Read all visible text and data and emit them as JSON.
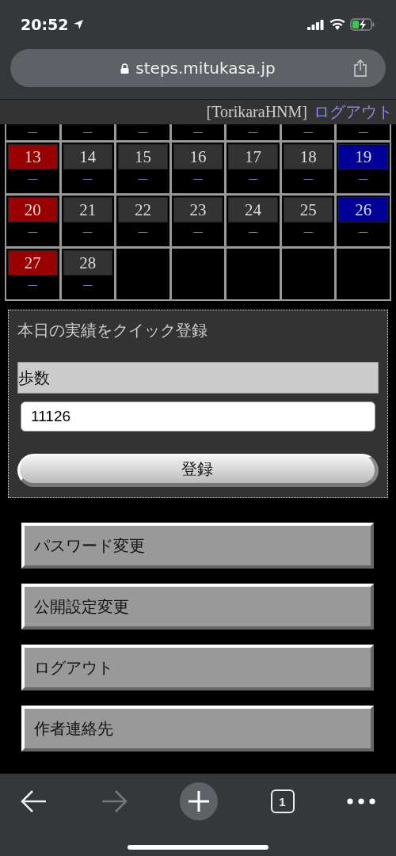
{
  "status_bar": {
    "time": "20:52"
  },
  "browser": {
    "url": "steps.mitukasa.jp",
    "tab_count": "1",
    "forward_disabled": true
  },
  "user_bar": {
    "user": "[TorikaraHNM]",
    "logout_link": "ログアウト"
  },
  "calendar": {
    "weeks": [
      {
        "days": [
          {
            "kind": "cut",
            "value": "—"
          },
          {
            "kind": "cut",
            "value": "—"
          },
          {
            "kind": "cut",
            "value": "—"
          },
          {
            "kind": "cut",
            "value": "—"
          },
          {
            "kind": "cut",
            "value": "—"
          },
          {
            "kind": "cut",
            "value": "—"
          },
          {
            "kind": "cut",
            "value": "—"
          }
        ]
      },
      {
        "days": [
          {
            "kind": "sunday",
            "day": "13",
            "value": "—"
          },
          {
            "kind": "weekday",
            "day": "14",
            "value": "—"
          },
          {
            "kind": "weekday",
            "day": "15",
            "value": "—"
          },
          {
            "kind": "weekday",
            "day": "16",
            "value": "—"
          },
          {
            "kind": "weekday",
            "day": "17",
            "value": "—"
          },
          {
            "kind": "weekday",
            "day": "18",
            "value": "—"
          },
          {
            "kind": "saturday",
            "day": "19",
            "value": "—"
          }
        ]
      },
      {
        "days": [
          {
            "kind": "sunday",
            "day": "20",
            "value": "—"
          },
          {
            "kind": "weekday",
            "day": "21",
            "value": "—"
          },
          {
            "kind": "weekday",
            "day": "22",
            "value": "—"
          },
          {
            "kind": "weekday",
            "day": "23",
            "value": "—"
          },
          {
            "kind": "weekday",
            "day": "24",
            "value": "—"
          },
          {
            "kind": "weekday",
            "day": "25",
            "value": "—"
          },
          {
            "kind": "saturday",
            "day": "26",
            "value": "—"
          }
        ]
      },
      {
        "days": [
          {
            "kind": "sunday",
            "day": "27",
            "value": "—"
          },
          {
            "kind": "weekday",
            "day": "28",
            "value": "—"
          },
          {
            "kind": "empty"
          },
          {
            "kind": "empty"
          },
          {
            "kind": "empty"
          },
          {
            "kind": "empty"
          },
          {
            "kind": "empty"
          }
        ]
      }
    ]
  },
  "quick_entry": {
    "title": "本日の実績をクイック登録",
    "field_label": "歩数",
    "value": "11126",
    "submit": "登録"
  },
  "menu": [
    "パスワード変更",
    "公開設定変更",
    "ログアウト",
    "作者連絡先"
  ]
}
